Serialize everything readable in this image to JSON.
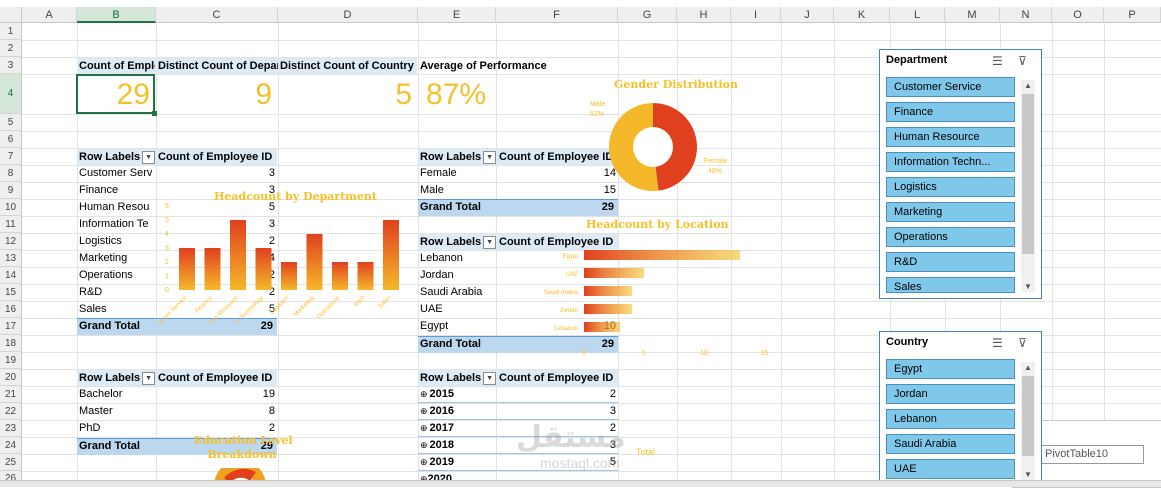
{
  "columns": [
    "A",
    "B",
    "C",
    "D",
    "E",
    "F",
    "G",
    "H",
    "I",
    "J",
    "K",
    "L",
    "M",
    "N",
    "O",
    "P"
  ],
  "rows": [
    "1",
    "2",
    "3",
    "4",
    "5",
    "6",
    "7",
    "8",
    "9",
    "10",
    "11",
    "12",
    "13",
    "14",
    "15",
    "16",
    "17",
    "18",
    "19",
    "20",
    "21",
    "22",
    "23",
    "24",
    "25",
    "26"
  ],
  "kpis": {
    "employee_count": {
      "label": "Count of Emplo",
      "value": "29"
    },
    "department_count": {
      "label": "Distinct Count of Depart",
      "value": "9"
    },
    "country_count": {
      "label": "Distinct Count of Country",
      "value": "5"
    },
    "performance": {
      "label": "Average of Performance",
      "value": "87%"
    }
  },
  "dept_table": {
    "row_label": "Row Labels",
    "value_label": "Count of Employee ID",
    "rows": [
      {
        "label": "Customer Serv",
        "value": "3"
      },
      {
        "label": "Finance",
        "value": "3"
      },
      {
        "label": "Human Resou",
        "value": "5"
      },
      {
        "label": "Information Te",
        "value": "3"
      },
      {
        "label": "Logistics",
        "value": "2"
      },
      {
        "label": "Marketing",
        "value": "4"
      },
      {
        "label": "Operations",
        "value": "2"
      },
      {
        "label": "R&D",
        "value": "2"
      },
      {
        "label": "Sales",
        "value": "5"
      }
    ],
    "total_label": "Grand Total",
    "total": "29"
  },
  "edu_table": {
    "row_label": "Row Labels",
    "value_label": "Count of Employee ID",
    "rows": [
      {
        "label": "Bachelor",
        "value": "19"
      },
      {
        "label": "Master",
        "value": "8"
      },
      {
        "label": "PhD",
        "value": "2"
      }
    ],
    "total_label": "Grand Total",
    "total": "29"
  },
  "gender_table": {
    "row_label": "Row Labels",
    "value_label": "Count of Employee ID",
    "rows": [
      {
        "label": "Female",
        "value": "14"
      },
      {
        "label": "Male",
        "value": "15"
      }
    ],
    "total_label": "Grand Total",
    "total": "29"
  },
  "location_table": {
    "row_label": "Row Labels",
    "value_label": "Count of Employee ID",
    "rows": [
      {
        "label": "Lebanon",
        "value": ""
      },
      {
        "label": "Jordan",
        "value": ""
      },
      {
        "label": "Saudi Arabia",
        "value": ""
      },
      {
        "label": "UAE",
        "value": ""
      },
      {
        "label": "Egypt",
        "value": "10"
      }
    ],
    "total_label": "Grand Total",
    "total": "29"
  },
  "year_table": {
    "row_label": "Row Labels",
    "value_label": "Count of Employee ID",
    "rows": [
      {
        "label": "2015",
        "value": "2"
      },
      {
        "label": "2016",
        "value": "3"
      },
      {
        "label": "2017",
        "value": "2"
      },
      {
        "label": "2018",
        "value": "3"
      },
      {
        "label": "2019",
        "value": "5"
      }
    ],
    "partial_row": "2020"
  },
  "charts": {
    "gender": {
      "title": "Gender Distribution",
      "male_label": "Male",
      "male_pct": "52%",
      "female_label": "Female",
      "female_pct": "48%"
    },
    "dept": {
      "title": "Headcount by Department",
      "y_ticks": [
        "0",
        "1",
        "2",
        "3",
        "4",
        "5",
        "6"
      ]
    },
    "location": {
      "title": "Headcount by Location",
      "x_ticks": [
        "0",
        "5",
        "10",
        "15"
      ]
    },
    "education": {
      "title_line1": "Education Level",
      "title_line2": "Breakdown"
    },
    "years": {
      "total_label": "Total"
    }
  },
  "slicers": {
    "department": {
      "title": "Department",
      "items": [
        "Customer Service",
        "Finance",
        "Human Resource",
        "Information Techn...",
        "Logistics",
        "Marketing",
        "Operations",
        "R&D",
        "Sales"
      ]
    },
    "country": {
      "title": "Country",
      "items": [
        "Egypt",
        "Jordan",
        "Lebanon",
        "Saudi Arabia",
        "UAE"
      ]
    }
  },
  "pivot_name_box": "PivotTable10",
  "watermark": {
    "arabic": "مستقل",
    "latin": "mostaql.com"
  },
  "colors": {
    "accent": "#f5c02a",
    "bar_dark": "#e0401e",
    "header_band": "#ddebf7",
    "total_band": "#bdd7ee",
    "slicer_item": "#80c8ea"
  },
  "chart_data": [
    {
      "type": "bar",
      "title": "Headcount by Department",
      "categories": [
        "Customer Service",
        "Finance",
        "Human Resource",
        "Information Technology",
        "Logistics",
        "Marketing",
        "Operations",
        "R&D",
        "Sales"
      ],
      "values": [
        3,
        3,
        5,
        3,
        2,
        4,
        2,
        2,
        5
      ],
      "ylim": [
        0,
        6
      ]
    },
    {
      "type": "pie",
      "title": "Gender Distribution",
      "categories": [
        "Male",
        "Female"
      ],
      "values": [
        52,
        48
      ]
    },
    {
      "type": "bar",
      "title": "Headcount by Location",
      "orientation": "horizontal",
      "categories": [
        "Egypt",
        "UAE",
        "Saudi Arabia",
        "Jordan",
        "Lebanon"
      ],
      "values": [
        13,
        5,
        4,
        4,
        3
      ],
      "xlim": [
        0,
        15
      ]
    }
  ]
}
